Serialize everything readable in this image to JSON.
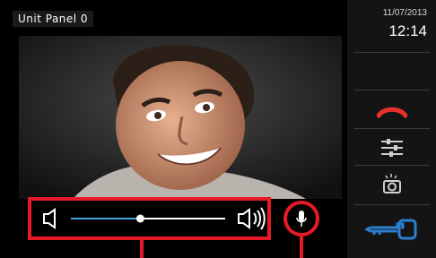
{
  "header": {
    "panel_label": "Unit Panel 0"
  },
  "status": {
    "date": "11/07/2013",
    "time": "12:14"
  },
  "audio": {
    "volume_level_fraction": 0.45
  },
  "icons": {
    "volume_low": "speaker-low-icon",
    "volume_high": "speaker-high-icon",
    "microphone": "microphone-icon",
    "hangup": "hangup-icon",
    "settings": "sliders-icon",
    "snapshot": "camera-icon",
    "door_open": "key-icon"
  },
  "colors": {
    "accent_red": "#e61a26",
    "slider_blue": "#4aa3df",
    "key_blue": "#2b7fd0"
  }
}
